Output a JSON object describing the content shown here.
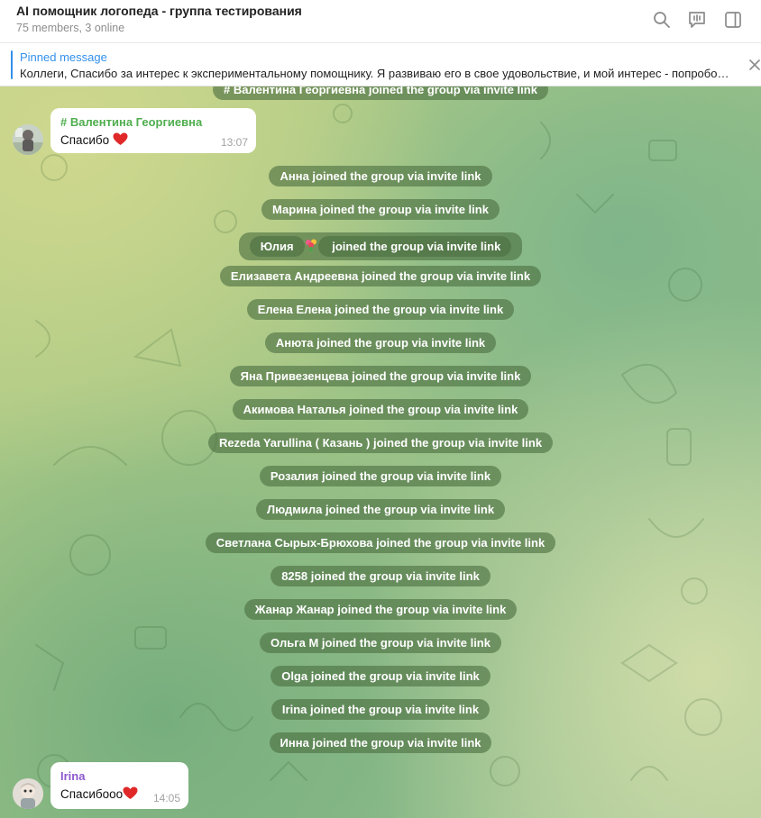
{
  "header": {
    "title": "AI помощник логопеда - группа тестирования",
    "subtitle": "75 members, 3 online"
  },
  "pinned": {
    "label": "Pinned message",
    "text": "Коллеги, Спасибо за интерес к экспериментальному помощнику. Я развиваю его в свое удовольствие, и мой интерес  - попробовать, насколько эта технология может быть полезной"
  },
  "top_partial_service": "# Валентина Георгиевна joined the group via invite link",
  "messages": [
    {
      "author": "# Валентина Георгиевна",
      "author_color": "#4fae4e",
      "text": "Спасибо",
      "emoji": "heart",
      "time": "13:07"
    },
    {
      "author": "Irina",
      "author_color": "#8e59cf",
      "text": "Спасибооо",
      "emoji": "heart",
      "time": "14:05"
    }
  ],
  "service_messages": [
    {
      "name": "Анна",
      "text": "Анна joined the group via invite link"
    },
    {
      "name": "Марина",
      "text": "Марина joined the group via invite link"
    },
    {
      "name": "Юлия",
      "text_before": "Юлия",
      "emoji": "bouquet",
      "text_after": " joined the group via invite link"
    },
    {
      "name": "Елизавета Андреевна",
      "text": "Елизавета Андреевна joined the group via invite link"
    },
    {
      "name": "Елена Елена",
      "text": "Елена Елена joined the group via invite link"
    },
    {
      "name": "Анюта",
      "text": "Анюта joined the group via invite link"
    },
    {
      "name": "Яна Привезенцева",
      "text": "Яна Привезенцева joined the group via invite link"
    },
    {
      "name": "Акимова Наталья",
      "text": "Акимова Наталья joined the group via invite link"
    },
    {
      "name": "Rezeda Yarullina ( Казань )",
      "text": "Rezeda Yarullina ( Казань ) joined the group via invite link"
    },
    {
      "name": "Розалия",
      "text": "Розалия joined the group via invite link"
    },
    {
      "name": "Людмила",
      "text": "Людмила joined the group via invite link"
    },
    {
      "name": "Светлана Сырых-Брюхова",
      "text": "Светлана Сырых-Брюхова joined the group via invite link"
    },
    {
      "name": "8258",
      "text": "8258 joined the group via invite link"
    },
    {
      "name": "Жанар Жанар",
      "text": "Жанар Жанар joined the group via invite link"
    },
    {
      "name": "Ольга М",
      "text": "Ольга М joined the group via invite link"
    },
    {
      "name": "Olga",
      "text": "Olga joined the group via invite link"
    },
    {
      "name": "Irina",
      "text": "Irina joined the group via invite link"
    },
    {
      "name": "Инна",
      "text": "Инна joined the group via invite link"
    }
  ],
  "icons": {
    "search": "search-icon",
    "voice_chat": "voice-chat-icon",
    "sidebar": "sidebar-toggle-icon",
    "close": "close-icon"
  },
  "colors": {
    "accent": "#3390ec",
    "service_bg": "#4c7040",
    "author1": "#4fae4e",
    "author2": "#8e59cf"
  }
}
